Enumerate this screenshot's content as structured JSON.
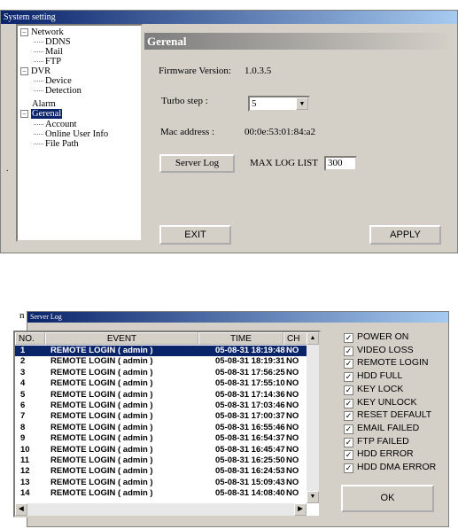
{
  "system_window": {
    "title": "System setting",
    "tree": [
      {
        "label": "Network",
        "toggle": "−"
      },
      {
        "label": "DDNS"
      },
      {
        "label": "Mail"
      },
      {
        "label": "FTP"
      },
      {
        "label": "DVR",
        "toggle": "−"
      },
      {
        "label": "Device"
      },
      {
        "label": "Detection"
      },
      {
        "label": "Alarm"
      },
      {
        "label": "Gerenal",
        "toggle": "−"
      },
      {
        "label": "Account"
      },
      {
        "label": "Online User Info"
      },
      {
        "label": "File Path"
      }
    ],
    "panel_title": "Gerenal",
    "firmware_label": "Firmware Version:",
    "firmware_value": "1.0.3.5",
    "turbo_label": "Turbo step :",
    "turbo_value": "5",
    "mac_label": "Mac address :",
    "mac_value": "00:0e:53:01:84:a2",
    "server_log_button": "Server Log",
    "max_log_label": "MAX LOG LIST",
    "max_log_value": "300",
    "exit_button": "EXIT",
    "apply_button": "APPLY",
    "side_mark": "."
  },
  "server_log": {
    "title": "Server Log",
    "columns": [
      "NO.",
      "EVENT",
      "TIME",
      "CH"
    ],
    "rows": [
      {
        "no": "1",
        "event": "REMOTE LOGIN ( admin )",
        "time": "05-08-31 18:19:48",
        "ch": "NO"
      },
      {
        "no": "2",
        "event": "REMOTE LOGIN ( admin )",
        "time": "05-08-31 18:19:31",
        "ch": "NO"
      },
      {
        "no": "3",
        "event": "REMOTE LOGIN ( admin )",
        "time": "05-08-31 17:56:25",
        "ch": "NO"
      },
      {
        "no": "4",
        "event": "REMOTE LOGIN ( admin )",
        "time": "05-08-31 17:55:10",
        "ch": "NO"
      },
      {
        "no": "5",
        "event": "REMOTE LOGIN ( admin )",
        "time": "05-08-31 17:14:36",
        "ch": "NO"
      },
      {
        "no": "6",
        "event": "REMOTE LOGIN ( admin )",
        "time": "05-08-31 17:03:46",
        "ch": "NO"
      },
      {
        "no": "7",
        "event": "REMOTE LOGIN ( admin )",
        "time": "05-08-31 17:00:37",
        "ch": "NO"
      },
      {
        "no": "8",
        "event": "REMOTE LOGIN ( admin )",
        "time": "05-08-31 16:55:46",
        "ch": "NO"
      },
      {
        "no": "9",
        "event": "REMOTE LOGIN ( admin )",
        "time": "05-08-31 16:54:37",
        "ch": "NO"
      },
      {
        "no": "10",
        "event": "REMOTE LOGIN ( admin )",
        "time": "05-08-31 16:45:47",
        "ch": "NO"
      },
      {
        "no": "11",
        "event": "REMOTE LOGIN ( admin )",
        "time": "05-08-31 16:25:50",
        "ch": "NO"
      },
      {
        "no": "12",
        "event": "REMOTE LOGIN ( admin )",
        "time": "05-08-31 16:24:53",
        "ch": "NO"
      },
      {
        "no": "13",
        "event": "REMOTE LOGIN ( admin )",
        "time": "05-08-31 15:09:43",
        "ch": "NO"
      },
      {
        "no": "14",
        "event": "REMOTE LOGIN ( admin )",
        "time": "05-08-31 14:08:40",
        "ch": "NO"
      }
    ],
    "filters": [
      "POWER ON",
      "VIDEO LOSS",
      "REMOTE LOGIN",
      "HDD FULL",
      "KEY LOCK",
      "KEY UNLOCK",
      "RESET DEFAULT",
      "EMAIL FAILED",
      "FTP FAILED",
      "HDD ERROR",
      "HDD DMA ERROR"
    ],
    "check_mark": "✓",
    "ok_button": "OK",
    "side_mark": "n"
  },
  "icons": {
    "dropdown": "chevron-down-icon",
    "scroll_up": "arrow-up-icon",
    "scroll_down": "arrow-down-icon",
    "scroll_left": "arrow-left-icon",
    "scroll_right": "arrow-right-icon"
  },
  "colors": {
    "titlebar": "#0a246a",
    "face": "#d4d0c8",
    "selection": "#0a246a"
  }
}
